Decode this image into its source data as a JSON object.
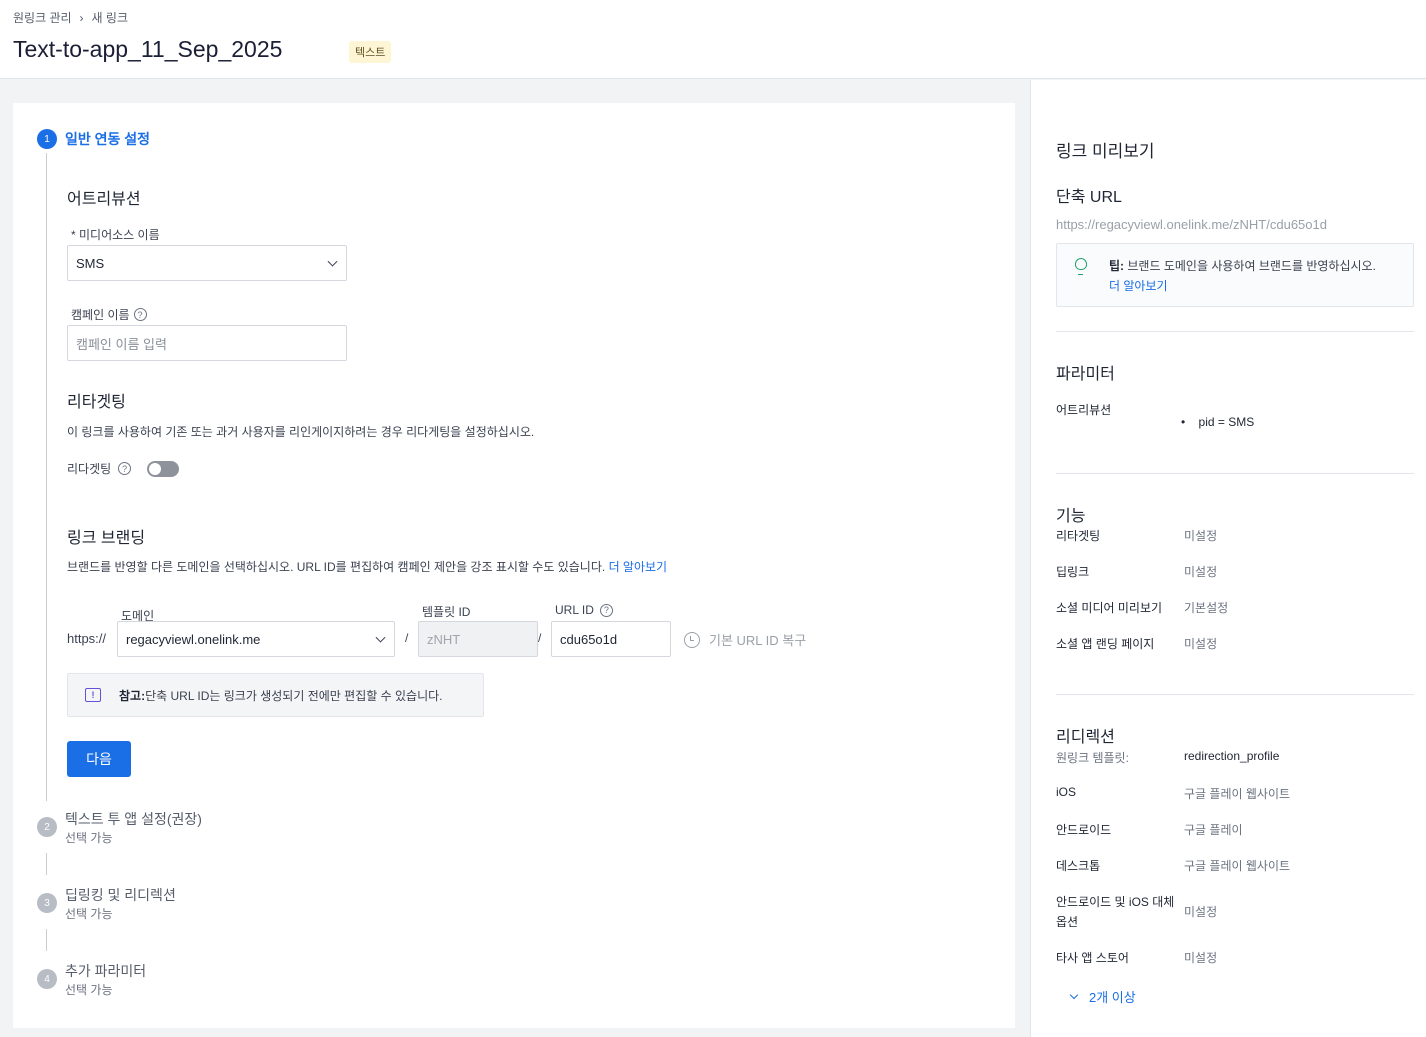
{
  "breadcrumb": {
    "parent": "원링크 관리",
    "current": "새 링크"
  },
  "page": {
    "title": "Text-to-app_11_Sep_2025",
    "badge": "텍스트"
  },
  "steps": [
    {
      "number": "1",
      "title": "일반 연동 설정"
    },
    {
      "number": "2",
      "title": "텍스트 투 앱 설정(권장)",
      "sub": "선택 가능"
    },
    {
      "number": "3",
      "title": "딥링킹 및 리디렉션",
      "sub": "선택 가능"
    },
    {
      "number": "4",
      "title": "추가 파라미터",
      "sub": "선택 가능"
    }
  ],
  "attribution": {
    "heading": "어트리뷰션",
    "media_source_label": "* 미디어소스 이름",
    "media_source_value": "SMS",
    "campaign_label": "캠페인 이름",
    "campaign_placeholder": "캠페인 이름 입력"
  },
  "retargeting": {
    "heading": "리타겟팅",
    "desc": "이 링크를 사용하여 기존 또는 과거 사용자를 리인게이지하려는 경우 리다게팅을 설정하십시오.",
    "toggle_label": "리다겟팅",
    "enabled": false
  },
  "branding": {
    "heading": "링크 브랜딩",
    "desc": "브랜드를 반영할 다른 도메인을 선택하십시오. URL ID를 편집하여 캠페인 제안을 강조 표시할 수도 있습니다.",
    "learn_more": "더 알아보기",
    "prefix": "https://",
    "domain_label": "도메인",
    "domain_value": "regacyviewl.onelink.me",
    "template_label": "템플릿 ID",
    "template_value": "zNHT",
    "urlid_label": "URL ID",
    "urlid_value": "cdu65o1d",
    "slash": "/",
    "restore_label": "기본 URL ID 복구",
    "note_bold": "참고:",
    "note_text": " 단축 URL ID는 링크가 생성되기 전에만 편집할 수 있습니다."
  },
  "next_button": "다음",
  "preview": {
    "title": "링크 미리보기",
    "short_url_heading": "단축 URL",
    "short_url": "https://regacyviewl.onelink.me/zNHT/cdu65o1d",
    "tip_bold": "팁:",
    "tip_text": " 브랜드 도메인을 사용하여 브랜드를 반영하십시오.",
    "tip_link": "더 알아보기",
    "params_heading": "파라미터",
    "params_label": "어트리뷰션",
    "params_value": "pid = SMS",
    "features_heading": "기능",
    "features": [
      {
        "label": "리타겟팅",
        "value": "미설정"
      },
      {
        "label": "딥링크",
        "value": "미설정"
      },
      {
        "label": "소셜 미디어 미리보기",
        "value": "기본설정"
      },
      {
        "label": "소셜 앱 랜딩 페이지",
        "value": "미설정"
      }
    ],
    "redirect_heading": "리디렉션",
    "redirect_template_label": "원링크 템플릿:",
    "redirect_template_value": "redirection_profile",
    "redirects": [
      {
        "label": "iOS",
        "value": "구글 플레이 웹사이트"
      },
      {
        "label": "안드로이드",
        "value": "구글 플레이"
      },
      {
        "label": "데스크톱",
        "value": "구글 플레이 웹사이트"
      },
      {
        "label": "안드로이드 및 iOS 대체 옵션",
        "value": "미설정"
      },
      {
        "label": "타사 앱 스토어",
        "value": "미설정"
      }
    ],
    "more_label": "2개 이상"
  }
}
